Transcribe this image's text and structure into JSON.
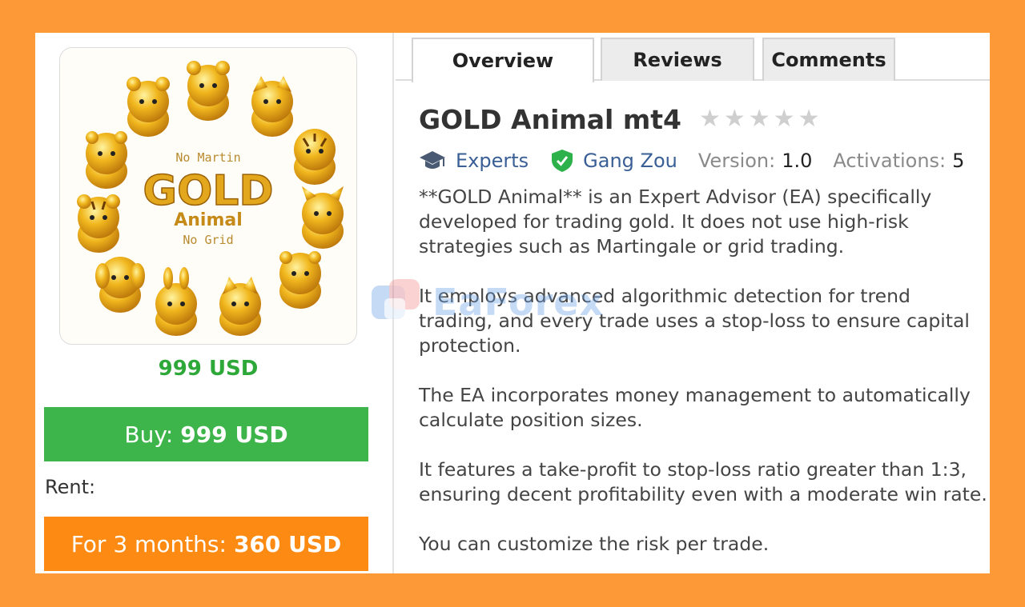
{
  "product": {
    "image_text": {
      "line1": "No Martin",
      "line2": "GOLD",
      "line3": "Animal",
      "line4": "No Grid"
    },
    "price": "999 USD",
    "buy": {
      "label": "Buy:",
      "amount": "999 USD"
    },
    "rent_label": "Rent:",
    "rent": {
      "label": "For 3 months:",
      "amount": "360 USD"
    }
  },
  "tabs": [
    {
      "label": "Overview",
      "active": true
    },
    {
      "label": "Reviews",
      "active": false
    },
    {
      "label": "Comments",
      "active": false
    }
  ],
  "title": "GOLD Animal mt4",
  "rating": 0,
  "meta": {
    "category": "Experts",
    "author": "Gang Zou",
    "version_label": "Version:",
    "version": "1.0",
    "activations_label": "Activations:",
    "activations": "5"
  },
  "description": [
    "**GOLD Animal** is an Expert Advisor (EA) specifically developed for trading gold. It does  not  use high-risk strategies such as Martingale or grid trading.",
    "It employs  advanced algorithmic detection for trend trading, and every trade uses a stop-loss  to ensure capital protection.",
    "The EA incorporates  money management  to automatically calculate position sizes.",
    "It features a  take-profit to stop-loss ratio greater than 1:3, ensuring decent profitability even with a moderate win rate.",
    "You can  customize the risk per trade."
  ],
  "watermark": "EaForex",
  "colors": {
    "background": "#fd9937",
    "buy": "#3eb54b",
    "rent": "#fd8a12",
    "price": "#2fa83a",
    "link": "#3a5f96"
  },
  "icons": {
    "category": "graduation-cap-icon",
    "author": "verified-shield-icon",
    "rating": "star-icon"
  }
}
